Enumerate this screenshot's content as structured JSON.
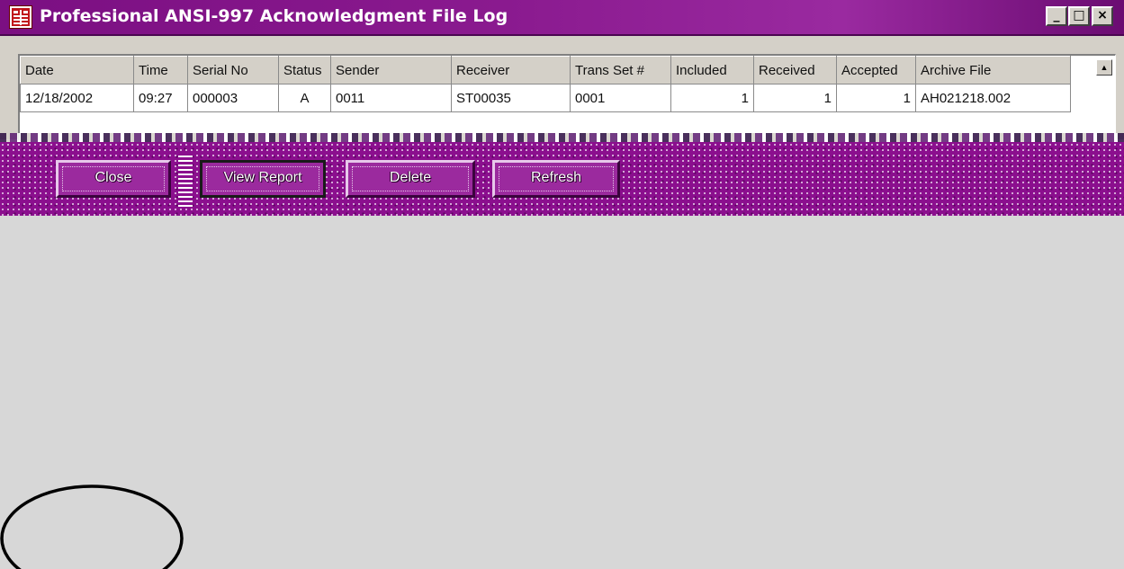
{
  "window": {
    "title": "Professional ANSI-997 Acknowledgment File Log",
    "controls": {
      "minimize": "_",
      "maximize": "□",
      "close": "×"
    }
  },
  "grid": {
    "columns": [
      "Date",
      "Time",
      "Serial No",
      "Status",
      "Sender",
      "Receiver",
      "Trans Set #",
      "Included",
      "Received",
      "Accepted",
      "Archive File"
    ],
    "rows": [
      {
        "date": "12/18/2002",
        "time": "09:27",
        "serial_no": "000003",
        "status": "A",
        "sender": "0011",
        "receiver": "ST00035",
        "trans_set": "0001",
        "included": "1",
        "received": "1",
        "accepted": "1",
        "archive_file": "AH021218.002"
      }
    ],
    "scroll_up_icon": "▲"
  },
  "buttons": {
    "close": "Close",
    "view_report": "View Report",
    "delete": "Delete",
    "refresh": "Refresh"
  },
  "colors": {
    "titlebar": "#7b0f82",
    "button_bar": "#8b0f8e",
    "client_area": "#d7d7d7",
    "annotation_circle": "#000000"
  },
  "icons": {
    "app": "app-icon",
    "annotation": "circle-annotation"
  }
}
